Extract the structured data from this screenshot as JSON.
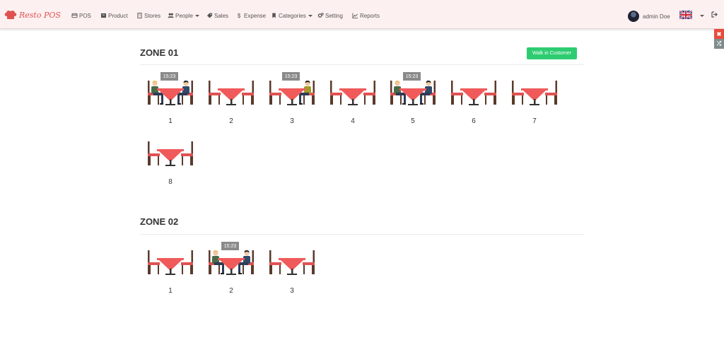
{
  "brand": {
    "logo_text": "Resto POS"
  },
  "nav": [
    {
      "label": "POS",
      "icon": "credit-card-icon"
    },
    {
      "label": "Product",
      "icon": "archive-icon"
    },
    {
      "label": "Stores",
      "icon": "building-icon"
    },
    {
      "label": "People",
      "icon": "users-icon",
      "dropdown": true
    },
    {
      "label": "Sales",
      "icon": "tag-icon"
    },
    {
      "label": "Expense",
      "icon": "dollar-icon"
    },
    {
      "label": "Categories",
      "icon": "bookmark-icon",
      "dropdown": true
    },
    {
      "label": "Setting",
      "icon": "cogs-icon"
    },
    {
      "label": "Reports",
      "icon": "chart-icon"
    }
  ],
  "user": {
    "name": "admin Doe"
  },
  "colors": {
    "accent": "#e05252",
    "walk_in": "#2ecc71",
    "table_top": "#f05a5a",
    "chair": "#5b3a2b",
    "seat": "#e05252"
  },
  "zones": [
    {
      "title": "ZONE 01",
      "walk_in_label": "Walk in Customer",
      "tables": [
        {
          "number": "1",
          "time": "15:23",
          "occupancy": "two"
        },
        {
          "number": "2",
          "time": "",
          "occupancy": "empty"
        },
        {
          "number": "3",
          "time": "15:23",
          "occupancy": "right"
        },
        {
          "number": "4",
          "time": "",
          "occupancy": "empty"
        },
        {
          "number": "5",
          "time": "15:23",
          "occupancy": "two"
        },
        {
          "number": "6",
          "time": "",
          "occupancy": "empty"
        },
        {
          "number": "7",
          "time": "",
          "occupancy": "empty"
        },
        {
          "number": "8",
          "time": "",
          "occupancy": "empty"
        }
      ]
    },
    {
      "title": "ZONE 02",
      "tables": [
        {
          "number": "1",
          "time": "",
          "occupancy": "empty"
        },
        {
          "number": "2",
          "time": "15:23",
          "occupancy": "two"
        },
        {
          "number": "3",
          "time": "",
          "occupancy": "empty"
        }
      ]
    }
  ]
}
